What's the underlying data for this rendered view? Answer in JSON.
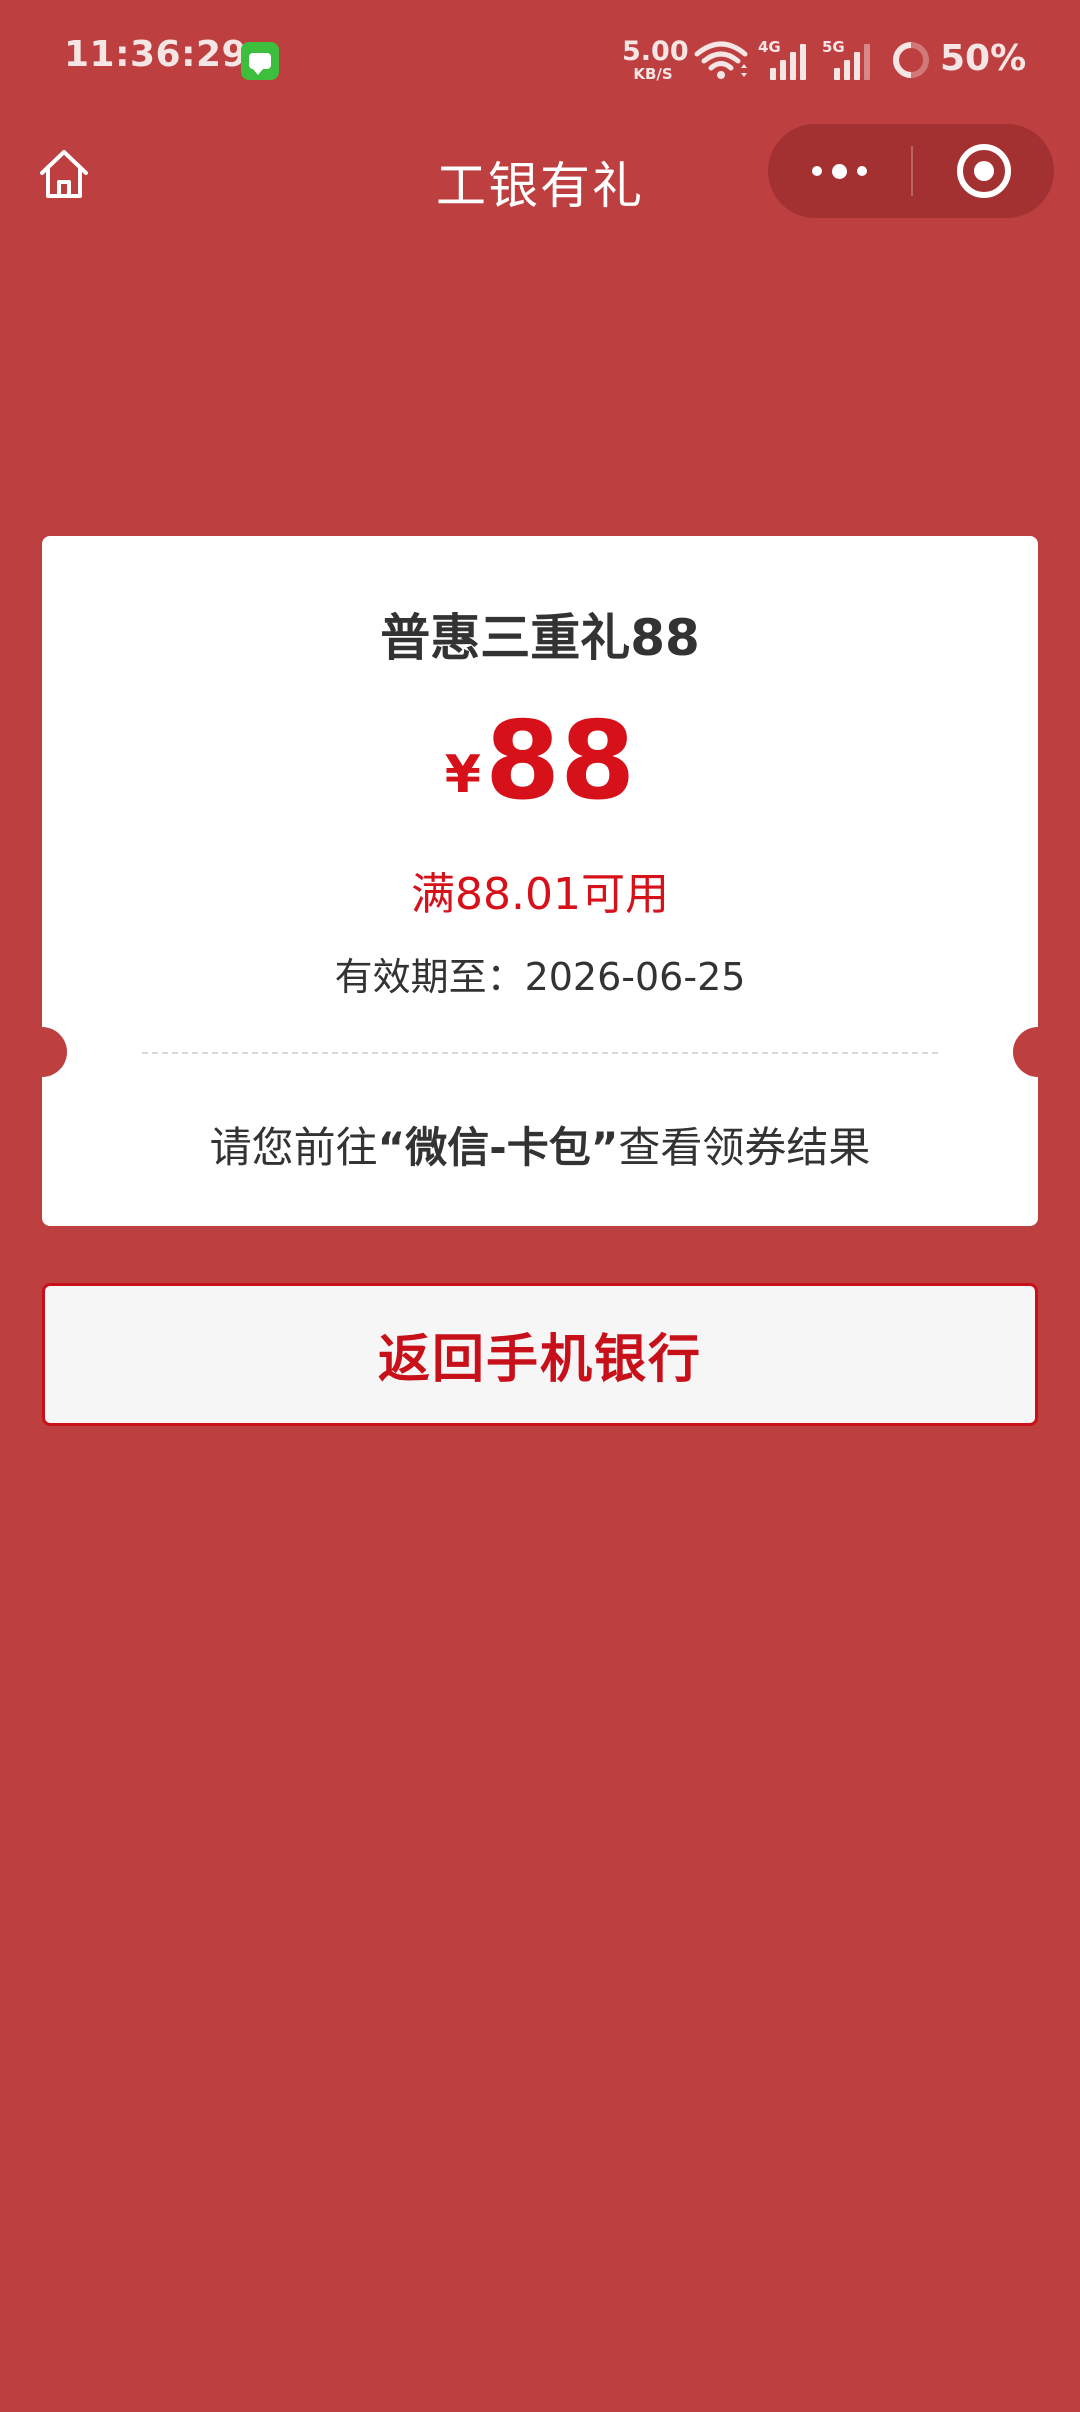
{
  "status_bar": {
    "time": "11:36:29",
    "net_speed_value": "5.00",
    "net_speed_unit": "KB/S",
    "signal_1_label": "4G",
    "signal_2_label": "5G",
    "battery": "50%"
  },
  "nav": {
    "title": "工银有礼"
  },
  "coupon": {
    "title": "普惠三重礼88",
    "currency": "¥",
    "amount": "88",
    "condition": "满88.01可用",
    "validity": "有效期至：2026-06-25",
    "hint_prefix": "请您前往",
    "hint_highlight": "“微信-卡包”",
    "hint_suffix": "查看领券结果"
  },
  "actions": {
    "return_label": "返回手机银行"
  },
  "colors": {
    "background": "#BD3F3F",
    "accent_red": "#D6111A",
    "button_red": "#C8101A",
    "card": "#FFFFFF"
  },
  "icons": {
    "home": "home-icon",
    "more": "more-dots-icon",
    "close": "target-close-icon",
    "wifi": "wifi-icon",
    "battery": "battery-ring-icon",
    "app": "message-app-icon"
  }
}
